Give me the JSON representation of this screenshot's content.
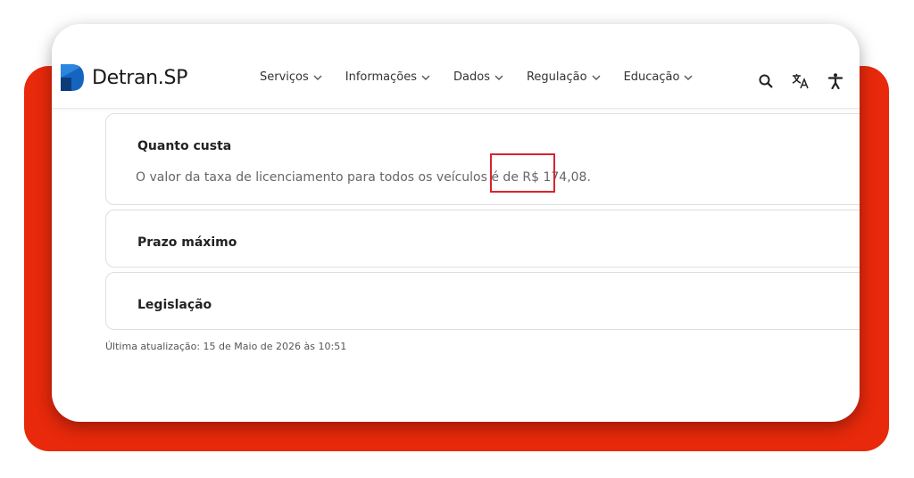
{
  "brand": {
    "name_part1": "Detran",
    "name_part2": ".SP",
    "red": "#e8290b",
    "blue": "#1565c0",
    "highlight_red": "#d9232d"
  },
  "nav": {
    "items": [
      {
        "label": "Serviços"
      },
      {
        "label": "Informações"
      },
      {
        "label": "Dados"
      },
      {
        "label": "Regulação"
      },
      {
        "label": "Educação"
      }
    ]
  },
  "tools": {
    "search_icon": "search-icon",
    "translate_icon": "translate-icon",
    "accessibility_icon": "accessibility-icon"
  },
  "sections": [
    {
      "title": "Quanto custa",
      "text_before": "O valor da taxa de licenciamento para todos os veículos é de ",
      "text_highlight": "R$ 174,08."
    },
    {
      "title": "Prazo máximo"
    },
    {
      "title": "Legislação"
    }
  ],
  "footer": {
    "updated": "Última atualização: 15 de Maio de 2026 às 10:51"
  }
}
